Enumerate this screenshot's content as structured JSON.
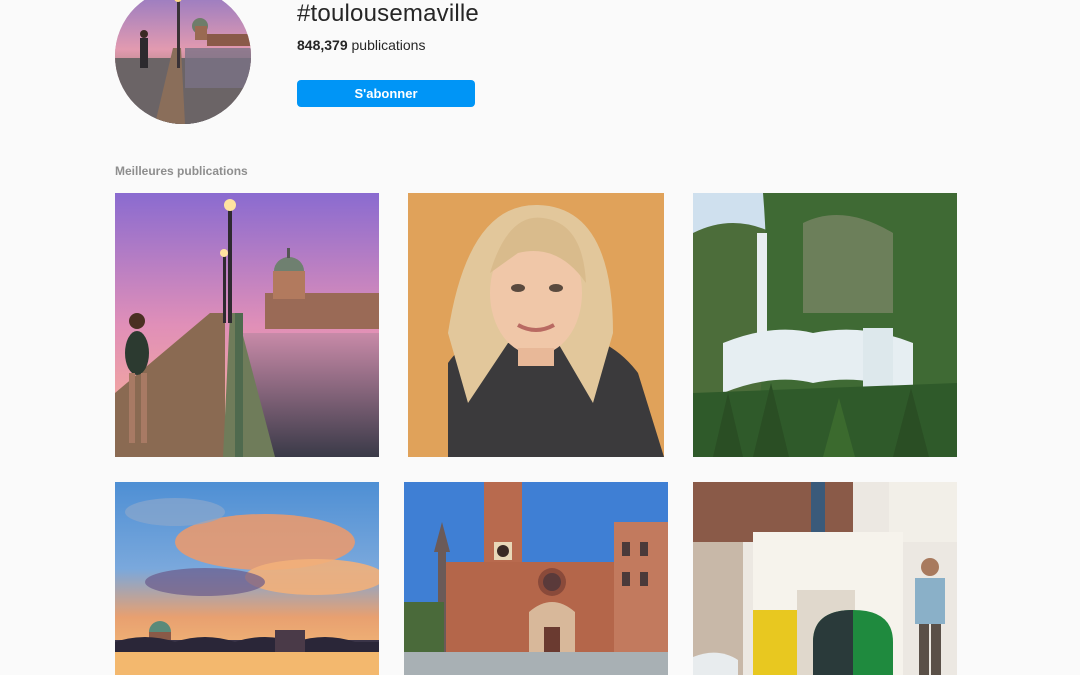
{
  "header": {
    "hashtag": "#toulousemaville",
    "pub_count": "848,379",
    "pub_label": "publications",
    "follow_label": "S'abonner"
  },
  "section": {
    "title": "Meilleures publications"
  },
  "posts": [
    {
      "subject": "Pont Saint-Pierre at dusk with Dôme de la Grave, woman walking with backpack"
    },
    {
      "subject": "Selfie of blonde woman in dark jacket against orange wall"
    },
    {
      "subject": "Mountain waterfall surrounded by forest"
    },
    {
      "subject": "Sunset sky over Pont Saint-Pierre and Dôme de la Grave"
    },
    {
      "subject": "Cathédrale Saint-Étienne brick facade with rose window"
    },
    {
      "subject": "Modern interior with geometric yellow and green artwork, man standing"
    }
  ],
  "colors": {
    "accent": "#0095f6",
    "background": "#fafafa",
    "muted_text": "#8e8e8e"
  }
}
